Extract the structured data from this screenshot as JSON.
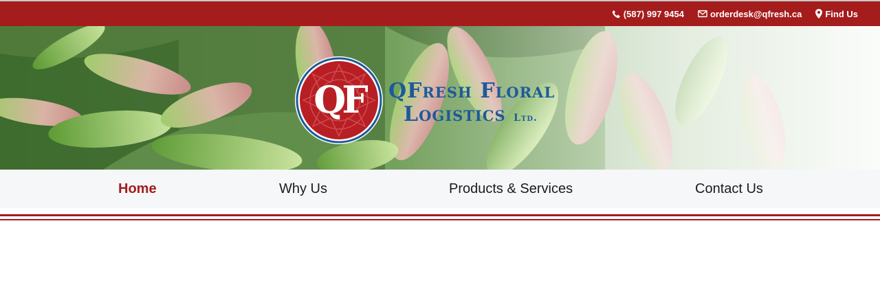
{
  "topbar": {
    "phone": "(587) 997 9454",
    "email": "orderdesk@qfresh.ca",
    "find_us": "Find Us",
    "background_color": "#a51c1c"
  },
  "logo": {
    "monogram": "QF",
    "name_line1": "QFresh Floral",
    "name_line2": "Logistics",
    "suffix": "Ltd.",
    "seal_color": "#b71f24",
    "text_color": "#1d5a9a"
  },
  "nav": {
    "items": [
      {
        "label": "Home",
        "active": true
      },
      {
        "label": "Why Us",
        "active": false
      },
      {
        "label": "Products & Services",
        "active": false
      },
      {
        "label": "Contact Us",
        "active": false
      }
    ],
    "active_color": "#a51c1c"
  }
}
